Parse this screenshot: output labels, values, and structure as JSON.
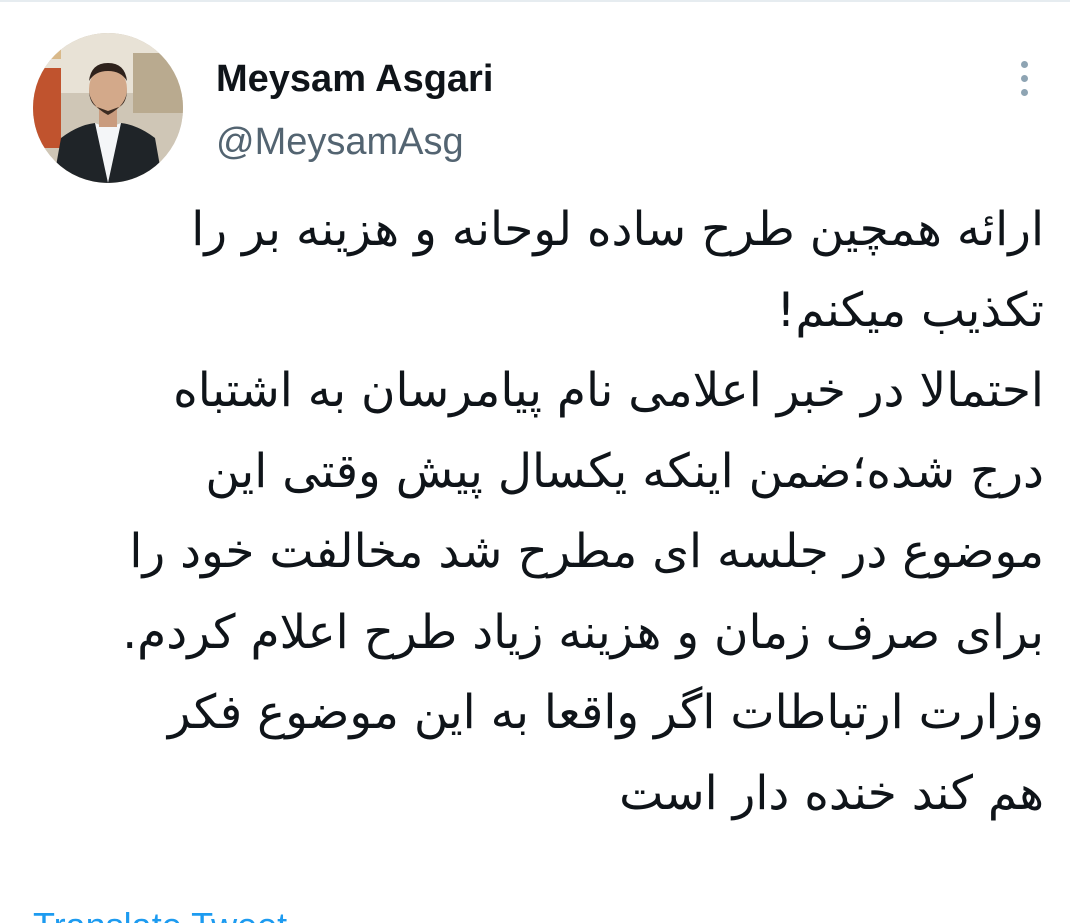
{
  "author": {
    "display_name": "Meysam Asgari",
    "handle": "@MeysamAsg"
  },
  "actions": {
    "more_icon": "more-vertical-icon"
  },
  "tweet": {
    "lines": [
      "ارائه همچین طرح ساده لوحانه و هزینه بر را",
      "تکذیب میکنم!",
      "احتمالا در خبر اعلامی نام پیامرسان به اشتباه",
      "درج شده؛ضمن اینکه یکسال پیش وقتی این",
      "موضوع در جلسه ای مطرح شد مخالفت خود را",
      "برای صرف زمان و هزینه زیاد طرح اعلام کردم.",
      "وزارت ارتباطات اگر واقعا به این موضوع فکر",
      "هم کند خنده دار است"
    ],
    "translate_label": "Translate Tweet"
  },
  "colors": {
    "text_primary": "#0f1419",
    "text_secondary": "#536471",
    "link": "#1d9bf0"
  }
}
